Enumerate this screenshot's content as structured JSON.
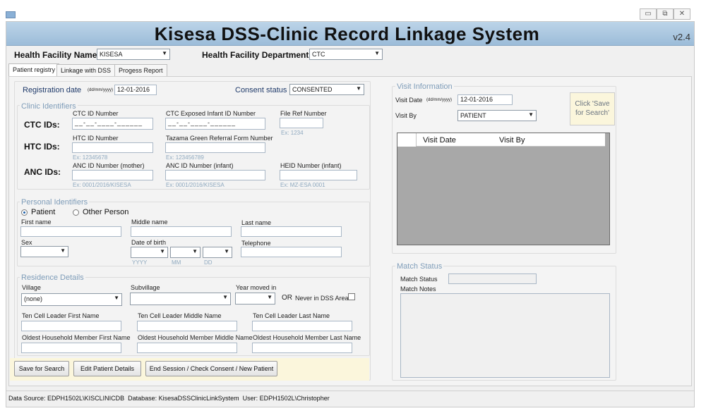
{
  "window": {
    "title": "Kisesa DSS-Clinic Record Linkage System",
    "version": "v2.4",
    "controls": [
      "▭",
      "⧉",
      "✕"
    ]
  },
  "header": {
    "facility_name_label": "Health Facility Name",
    "facility_name_value": "KISESA",
    "department_label": "Health Facility Department",
    "department_value": "CTC"
  },
  "tabs": [
    "Patient registry",
    "Linkage with DSS",
    "Progess Report"
  ],
  "registration": {
    "date_label": "Registration date",
    "date_format": "(dd/mm/yyyy)",
    "date_value": "12-01-2016",
    "consent_label": "Consent status",
    "consent_value": "CONSENTED"
  },
  "clinic_ids": {
    "group_label": "Clinic Identifiers",
    "ctc_label": "CTC IDs:",
    "htc_label": "HTC IDs:",
    "anc_label": "ANC IDs:",
    "ctc_id_number_label": "CTC ID Number",
    "ctc_id_value": "__-__-____-______",
    "ctc_exposed_label": "CTC Exposed Infant ID Number",
    "ctc_exposed_value": "__-__-____-______",
    "file_ref_label": "File Ref Number",
    "file_ref_hint": "Ex: 1234",
    "htc_id_label": "HTC ID Number",
    "htc_hint": "Ex: 12345678",
    "tazama_label": "Tazama Green Referral Form Number",
    "tazama_hint": "Ex: 123456789",
    "anc_mother_label": "ANC ID Number (mother)",
    "anc_mother_hint": "Ex: 0001/2016/KISESA",
    "anc_infant_label": "ANC ID Number (infant)",
    "anc_infant_hint": "Ex: 0001/2016/KISESA",
    "heid_label": "HEID Number (infant)",
    "heid_hint": "Ex: MZ-ESA 0001"
  },
  "personal": {
    "group_label": "Personal Identifiers",
    "radio_patient": "Patient",
    "radio_other": "Other Person",
    "first_name_label": "First name",
    "middle_name_label": "Middle name",
    "last_name_label": "Last name",
    "sex_label": "Sex",
    "dob_label": "Date of birth",
    "telephone_label": "Telephone",
    "dob_yyyy": "YYYY",
    "dob_mm": "MM",
    "dob_dd": "DD"
  },
  "residence": {
    "group_label": "Residence Details",
    "village_label": "Village",
    "village_value": "(none)",
    "subvillage_label": "Subvillage",
    "year_moved_label": "Year moved in",
    "or_label": "OR",
    "never_in_dss_label": "Never in DSS Area",
    "tcl_first_label": "Ten Cell Leader First Name",
    "tcl_middle_label": "Ten Cell Leader Middle Name",
    "tcl_last_label": "Ten Cell Leader Last Name",
    "ohm_first_label": "Oldest Household Member First Name",
    "ohm_middle_label": "Oldest Household Member Middle Name",
    "ohm_last_label": "Oldest Household Member Last Name"
  },
  "buttons": {
    "save": "Save for Search",
    "edit": "Edit Patient Details",
    "end_session": "End Session / Check Consent / New Patient",
    "click_save_hint": "Click 'Save for Search'"
  },
  "visit": {
    "group_label": "Visit Information",
    "visit_date_label": "Visit Date",
    "date_format": "(dd/mm/yyyy)",
    "visit_date_value": "12-01-2016",
    "visit_by_label": "Visit By",
    "visit_by_value": "PATIENT",
    "columns": [
      "Visit Date",
      "Visit By"
    ]
  },
  "match": {
    "group_label": "Match Status",
    "status_label": "Match Status",
    "notes_label": "Match Notes"
  },
  "statusbar": {
    "text": "Data Source: EDPH1502L\\KISCLINICDB  Database: KisesaDSSClinicLinkSystem  User: EDPH1502L\\Christopher"
  }
}
